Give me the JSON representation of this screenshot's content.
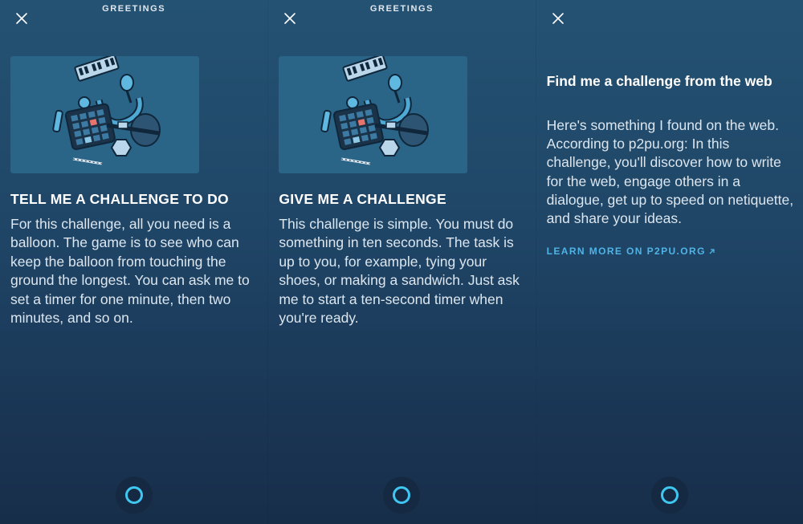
{
  "colors": {
    "accent": "#3fc7f2",
    "link": "#4fb3e8",
    "background_top": "#245273",
    "background_bottom": "#172e49",
    "card_image_bg": "#2a6486"
  },
  "icons": {
    "close": "close-icon",
    "alexa": "alexa-ring-icon",
    "external": "external-link-icon",
    "illustration": "music-instruments-illustration"
  },
  "screens": [
    {
      "title": "GREETINGS",
      "heading": "TELL ME A CHALLENGE TO DO",
      "body": "For this challenge, all you need is a balloon. The game is to see who can keep the balloon from touching the ground the longest. You can ask me to set a timer for one minute, then two minutes, and so on."
    },
    {
      "title": "GREETINGS",
      "heading": "GIVE ME A CHALLENGE",
      "body": "This challenge is simple. You must do something in ten seconds. The task is up to you, for example, tying your shoes, or making a sandwich. Just ask me to start a ten-second timer when you're ready."
    },
    {
      "title": "",
      "heading": "Find me a challenge from the web",
      "body": "Here's something I found on the web. According to p2pu.org: In this challenge, you'll discover how to write for the web,  engage others in a dialogue, get up to speed on netiquette, and share  your ideas.",
      "link_label": "LEARN MORE ON P2PU.ORG"
    }
  ]
}
